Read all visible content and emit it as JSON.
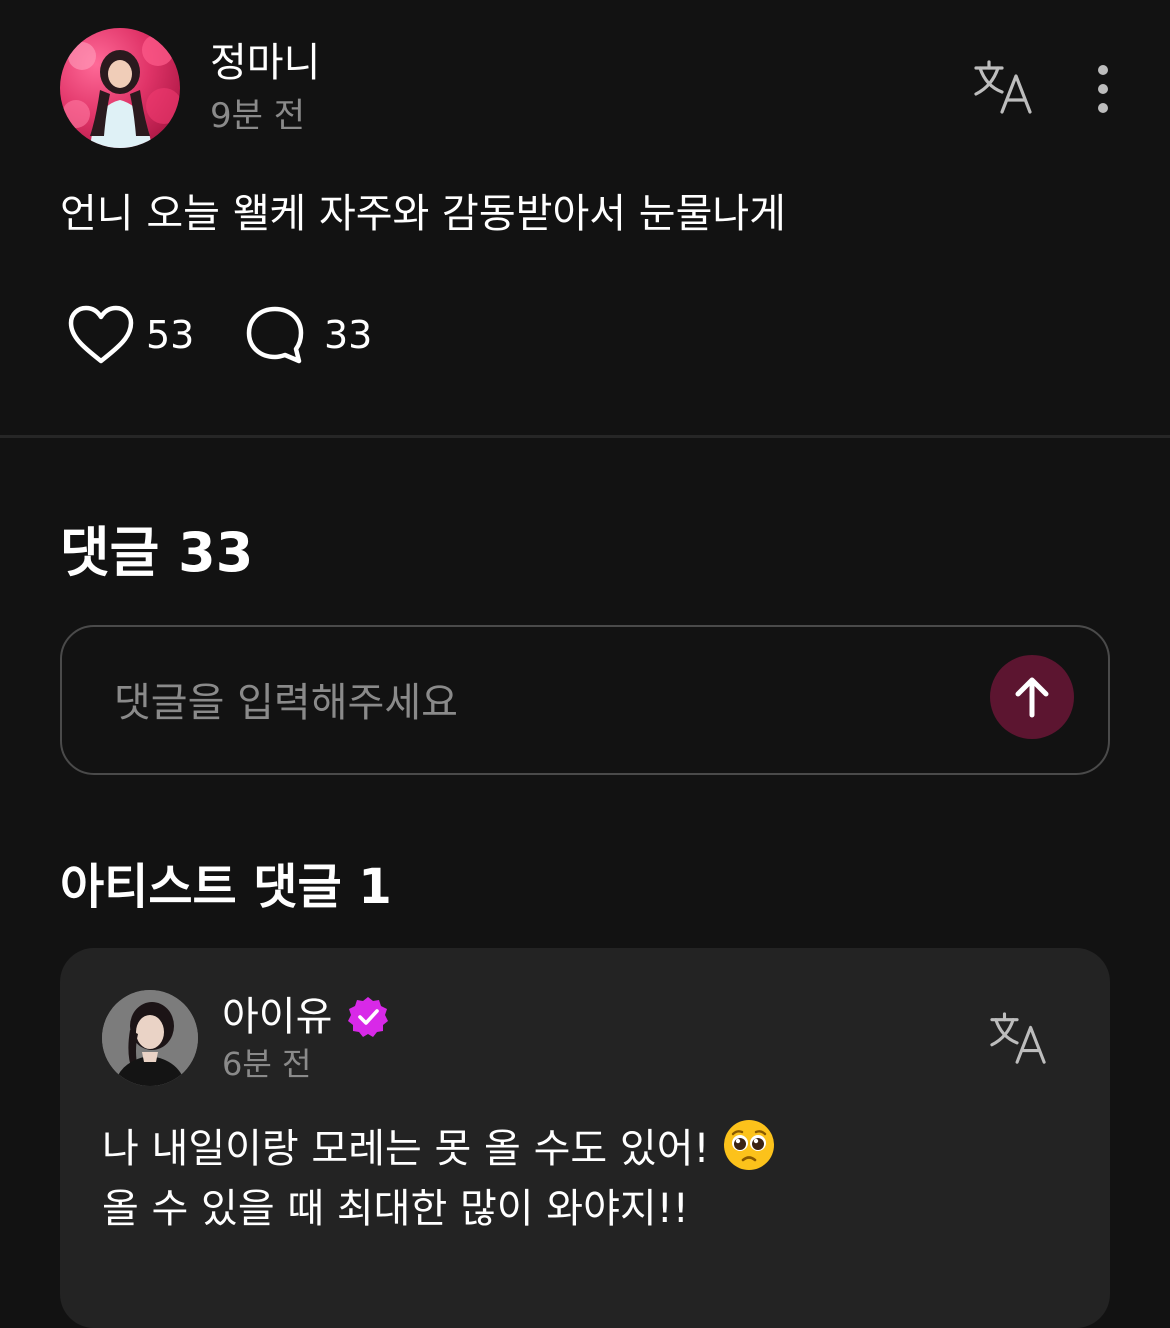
{
  "post": {
    "author": "정마니",
    "time": "9분 전",
    "body": "언니 오늘 왤케 자주와 감동받아서 눈물나게",
    "like_count": "53",
    "comment_count": "33",
    "icons": {
      "translate": "translate-icon",
      "more": "more-vertical-icon",
      "like": "heart-icon",
      "comment": "comment-bubble-icon"
    }
  },
  "comments_section": {
    "title": "댓글 33",
    "input_placeholder": "댓글을 입력해주세요",
    "input_value": "",
    "send_icon": "arrow-up-icon"
  },
  "artist_comments": {
    "title": "아티스트 댓글 1",
    "items": [
      {
        "name": "아이유",
        "time": "6분 전",
        "verified": true,
        "line1": "나 내일이랑 모레는 못 올 수도 있어!",
        "line2": "올 수 있을 때 최대한 많이 와야지!!",
        "emoji": "pleading-face-emoji"
      }
    ]
  },
  "colors": {
    "background": "#121212",
    "card": "#232323",
    "muted_text": "#8a8a8a",
    "send_button": "#5c1530",
    "verified_badge": "#d829e8"
  }
}
